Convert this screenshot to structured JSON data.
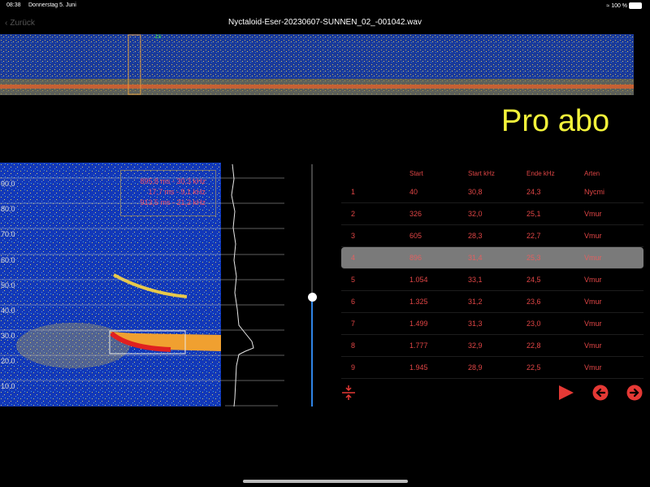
{
  "status": {
    "time": "08:38",
    "date": "Donnerstag 5. Juni",
    "battery": "100 %"
  },
  "nav": {
    "back_label": "Zurück",
    "title": "Nyctaloid-Eser-20230607-SUNNEN_02_-001042.wav"
  },
  "overview": {
    "marker_label": "1s"
  },
  "banner": {
    "text": "Pro abo"
  },
  "spectrogram": {
    "y_labels": [
      "90.0",
      "80.0",
      "70.0",
      "60.0",
      "50.0",
      "40.0",
      "30.0",
      "20.0",
      "10.0"
    ],
    "measurements": [
      "895,8  ms -  30,3  kHz",
      "17,7  ms -  9,1  kHz",
      "913,5  ms -  21,2  kHz"
    ]
  },
  "slider": {
    "value": 0.45
  },
  "table": {
    "headers": [
      "Start",
      "Start kHz",
      "Ende kHz",
      "Arten"
    ],
    "rows": [
      [
        "1",
        "40",
        "30,8",
        "24,3",
        "Nycmi"
      ],
      [
        "2",
        "326",
        "32,0",
        "25,1",
        "Vmur"
      ],
      [
        "3",
        "605",
        "28,3",
        "22,7",
        "Vmur"
      ],
      [
        "4",
        "896",
        "31,4",
        "25,3",
        "Vmur"
      ],
      [
        "5",
        "1.054",
        "33,1",
        "24,5",
        "Vmur"
      ],
      [
        "6",
        "1.325",
        "31,2",
        "23,6",
        "Vmur"
      ],
      [
        "7",
        "1.499",
        "31,3",
        "23,0",
        "Vmur"
      ],
      [
        "8",
        "1.777",
        "32,9",
        "22,8",
        "Vmur"
      ],
      [
        "9",
        "1.945",
        "28,9",
        "22,5",
        "Vmur"
      ]
    ],
    "selected_index": 3
  },
  "controls": {
    "zoom_icon": "zoom-fit-icon",
    "play_icon": "play-icon",
    "prev_icon": "arrow-left-circle-icon",
    "next_icon": "arrow-right-circle-icon"
  },
  "colors": {
    "accent": "#e53935",
    "banner": "#f3f33a",
    "slider": "#2f84e6"
  }
}
